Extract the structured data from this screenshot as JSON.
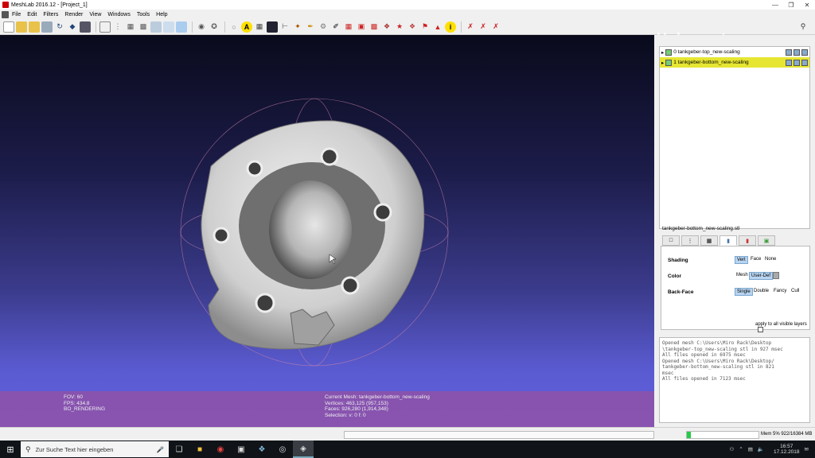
{
  "window": {
    "title": "MeshLab 2016.12 - [Project_1]",
    "minimize": "—",
    "maximize": "❐",
    "close": "✕"
  },
  "menu": [
    "File",
    "Edit",
    "Filters",
    "Render",
    "View",
    "Windows",
    "Tools",
    "Help"
  ],
  "watermark": "Holocreators",
  "layers": [
    {
      "label": "0  tankgeber-top_new-scaling",
      "selected": false
    },
    {
      "label": "1  tankgeber-bottom_new-scaling",
      "selected": true
    }
  ],
  "render_panel": {
    "title": "tankgeber-bottom_new-scaling.stl",
    "shading": {
      "label": "Shading",
      "options": [
        "Vert",
        "Face",
        "None"
      ],
      "selected": "Vert"
    },
    "color": {
      "label": "Color",
      "options": [
        "Mesh",
        "User-Def"
      ],
      "selected": "User-Def"
    },
    "backface": {
      "label": "Back-Face",
      "options": [
        "Single",
        "Double",
        "Fancy",
        "Cull"
      ],
      "selected": "Single"
    },
    "apply_label": "apply to all visible layers"
  },
  "log": [
    "Opened mesh C:\\Users\\Miro Rack\\Desktop",
    "\\tankgeber-top_new-scaling stl in 927 msec",
    "All files opened in 6975 msec",
    "Opened mesh C:\\Users\\Miro Rack\\Desktop/",
    "tankgeber-bottom_new-scaling stl in 821",
    "msec",
    "All files opened in 7123 msec"
  ],
  "viewport_info": {
    "fov": "FOV: 60",
    "fps": "FPS:   434.8",
    "rendering": "BO_RENDERING",
    "current_mesh": "Current Mesh: tankgeber-bottom_new-scaling",
    "vertices": "Vertices: 463,125    (957,153)",
    "faces": "Faces: 926,280    (1,914,348)",
    "selection": "Selection: v: 0 f: 0"
  },
  "memory": {
    "label": "Mem 5% 922/16384 MB",
    "fraction": 0.05
  },
  "taskbar": {
    "search_placeholder": "Zur Suche Text hier eingeben",
    "time": "16:57",
    "date": "17.12.2018"
  },
  "colors": {
    "selected_layer": "#e6e632",
    "viewport_top": "#0a0a1c",
    "viewport_bottom": "#6060e0",
    "info_bar": "#9650a0"
  }
}
